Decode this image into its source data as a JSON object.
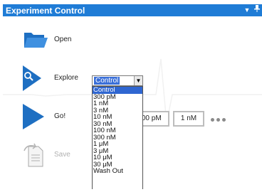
{
  "window": {
    "title": "Experiment Control",
    "controls": [
      "▼",
      "✕"
    ]
  },
  "actions": {
    "open": {
      "label": "Open",
      "icon": "folder-icon"
    },
    "explore": {
      "label": "Explore",
      "icon": "search-icon"
    },
    "go": {
      "label": "Go!",
      "icon": "play-icon"
    },
    "save": {
      "label": "Save",
      "icon": "save-document-icon",
      "enabled": false
    }
  },
  "explore_select": {
    "value": "Control",
    "options": [
      "Control",
      "300 pM",
      "1 nM",
      "3 nM",
      "10 nM",
      "30 nM",
      "100 nM",
      "300 nM",
      "1 μM",
      "3 μM",
      "10 μM",
      "30 μM",
      "Wash Out"
    ],
    "selected_index": 0
  },
  "concentration_buttons": [
    "300 pM",
    "1 nM"
  ],
  "more": "•••",
  "colors": {
    "titlebar": "#1f7cd6",
    "accent": "#1e6fc2",
    "selection": "#2f66d1"
  }
}
